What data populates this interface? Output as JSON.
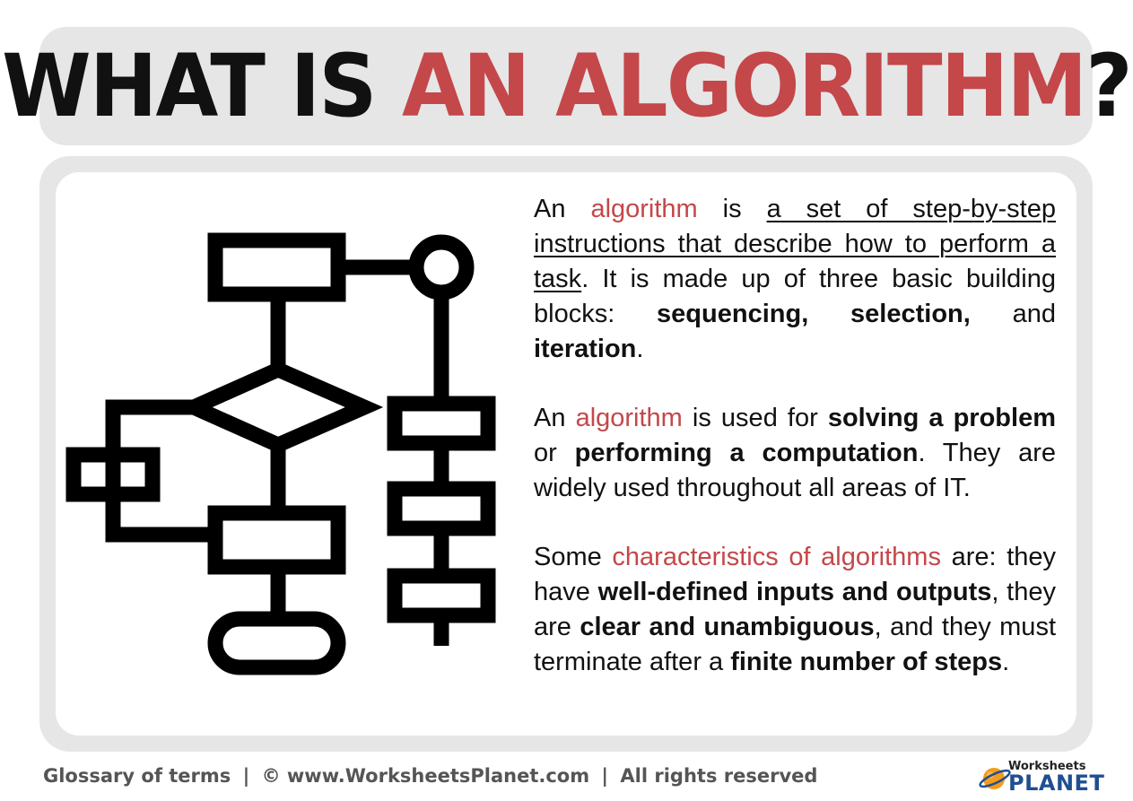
{
  "header": {
    "title_part1": "WHAT IS ",
    "title_part2": "AN ALGORITHM",
    "title_part3": "?"
  },
  "body": {
    "p1": {
      "s1": "An",
      "s2": "algorithm",
      "s3": "is",
      "s4": "a set of step-by-step instructions that describe how to perform a task",
      "s5": ". It is made up of three basic building blocks:",
      "s6": "sequencing,",
      "s7": "selection,",
      "s8": "and",
      "s9": "iteration",
      "s10": "."
    },
    "p2": {
      "s1": "An",
      "s2": "algorithm",
      "s3": "is used for",
      "s4": "solving a problem",
      "s5": "or",
      "s6": "performing a computation",
      "s7": ". They are widely used throughout all areas of IT."
    },
    "p3": {
      "s1": "Some",
      "s2": "characteristics of algorithms",
      "s3": "are: they have",
      "s4": "well-defined inputs and outputs",
      "s5": ", they are",
      "s6": "clear and unambiguous",
      "s7": ", and they must terminate after a",
      "s8": "finite number of steps",
      "s9": "."
    }
  },
  "footer": {
    "glossary": "Glossary of terms",
    "separator": "|",
    "copyright_symbol": "©",
    "website": "www.WorksheetsPlanet.com",
    "rights": "All rights reserved"
  },
  "brand": {
    "line1": "Worksheets",
    "line2": "PLANET"
  },
  "colors": {
    "accent": "#c4474a",
    "panel": "#e6e6e6",
    "brand_blue": "#1f4f92",
    "brand_orange": "#f29b1d"
  },
  "icons": {
    "illustration": "flowchart-icon",
    "logo": "planet-icon"
  }
}
